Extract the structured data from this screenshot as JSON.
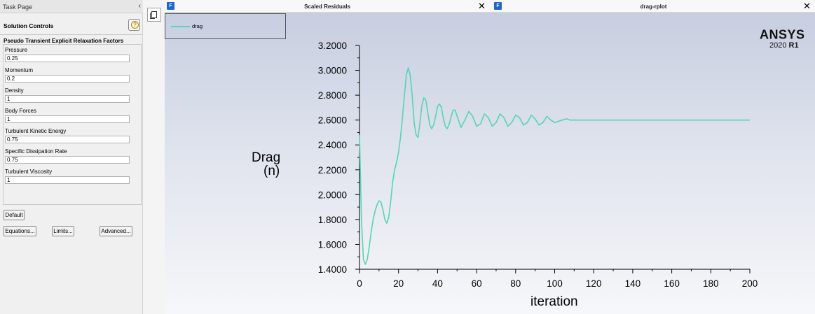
{
  "task_page": {
    "title": "Task Page",
    "collapse_glyph": "‹",
    "section_title": "Solution Controls",
    "help_glyph": "?",
    "subsection_title": "Pseudo Transient Explicit Relaxation Factors",
    "factors": [
      {
        "label": "Pressure",
        "value": "0.25"
      },
      {
        "label": "Momentum",
        "value": "0.2"
      },
      {
        "label": "Density",
        "value": "1"
      },
      {
        "label": "Body Forces",
        "value": "1"
      },
      {
        "label": "Turbulent Kinetic Energy",
        "value": "0.75"
      },
      {
        "label": "Specific Dissipation Rate",
        "value": "0.75"
      },
      {
        "label": "Turbulent Viscosity",
        "value": "1"
      }
    ],
    "buttons": {
      "default": "Default",
      "equations": "Equations...",
      "limits": "Limits...",
      "advanced": "Advanced..."
    }
  },
  "tabs": [
    {
      "icon": "F",
      "title": "Scaled Residuals",
      "close": "✕"
    },
    {
      "icon": "F",
      "title": "drag-rplot",
      "close": "✕"
    }
  ],
  "branding": {
    "logo": "ANSYS",
    "version_year": "2020",
    "version_release": "R1"
  },
  "colors": {
    "series": "#57d4b3",
    "panel_bg": "#f0f0f0",
    "graphics_top": "#c7cee0",
    "graphics_bottom": "#f6f7fa"
  },
  "chart_data": {
    "type": "line",
    "title": "",
    "ylabel_line1": "Drag",
    "ylabel_line2": "(n)",
    "xlabel": "iteration",
    "xlim": [
      0,
      200
    ],
    "ylim": [
      1.4,
      3.2
    ],
    "x_ticks": [
      "0",
      "20",
      "40",
      "60",
      "80",
      "100",
      "120",
      "140",
      "160",
      "180",
      "200"
    ],
    "y_ticks": [
      "1.4000",
      "1.6000",
      "1.8000",
      "2.0000",
      "2.2000",
      "2.4000",
      "2.6000",
      "2.8000",
      "3.0000",
      "3.2000"
    ],
    "legend": "top-left",
    "series": [
      {
        "name": "drag",
        "x": [
          0,
          1,
          2,
          3,
          4,
          5,
          6,
          7,
          8,
          9,
          10,
          11,
          12,
          13,
          14,
          15,
          16,
          17,
          18,
          19,
          20,
          21,
          22,
          23,
          24,
          25,
          26,
          27,
          28,
          29,
          30,
          31,
          32,
          33,
          34,
          35,
          36,
          37,
          38,
          39,
          40,
          41,
          42,
          43,
          44,
          45,
          46,
          47,
          48,
          49,
          50,
          52,
          54,
          56,
          58,
          60,
          62,
          64,
          66,
          68,
          70,
          72,
          74,
          76,
          78,
          80,
          82,
          84,
          86,
          88,
          90,
          92,
          94,
          96,
          98,
          100,
          102,
          104,
          106,
          108,
          110,
          112,
          115,
          120,
          130,
          140,
          150,
          160,
          170,
          180,
          190,
          200
        ],
        "y": [
          2.48,
          1.8,
          1.48,
          1.44,
          1.48,
          1.58,
          1.7,
          1.8,
          1.87,
          1.92,
          1.95,
          1.94,
          1.88,
          1.8,
          1.77,
          1.82,
          1.95,
          2.1,
          2.2,
          2.26,
          2.34,
          2.46,
          2.62,
          2.8,
          2.96,
          3.02,
          2.96,
          2.8,
          2.58,
          2.48,
          2.46,
          2.58,
          2.72,
          2.78,
          2.76,
          2.66,
          2.56,
          2.53,
          2.56,
          2.63,
          2.71,
          2.73,
          2.7,
          2.61,
          2.55,
          2.53,
          2.57,
          2.63,
          2.68,
          2.68,
          2.63,
          2.54,
          2.6,
          2.67,
          2.63,
          2.55,
          2.57,
          2.65,
          2.62,
          2.55,
          2.58,
          2.65,
          2.62,
          2.55,
          2.58,
          2.64,
          2.62,
          2.56,
          2.58,
          2.64,
          2.61,
          2.56,
          2.58,
          2.63,
          2.6,
          2.58,
          2.59,
          2.6,
          2.61,
          2.6,
          2.6,
          2.6,
          2.6,
          2.6,
          2.6,
          2.6,
          2.6,
          2.6,
          2.6,
          2.6,
          2.6,
          2.6
        ]
      }
    ]
  }
}
